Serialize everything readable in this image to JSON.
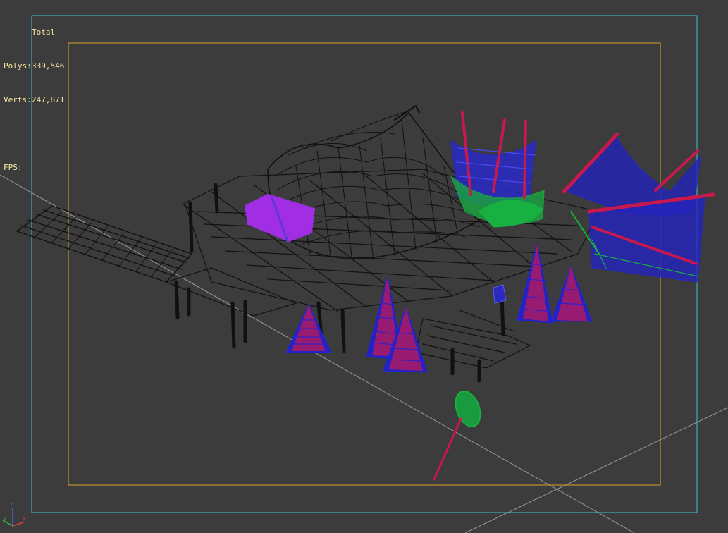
{
  "stats": {
    "header": "Total",
    "polys_label": "Polys:",
    "polys_value": "339,546",
    "verts_label": "Verts:",
    "verts_value": "247,871",
    "fps_label": "FPS:"
  },
  "colors": {
    "background": "#3c3c3c",
    "viewport_border": "#3fc0d0",
    "safe_frame": "#d8a030",
    "wire_black": "#111111",
    "wire_blue": "#2222d8",
    "wire_red": "#c8184c",
    "wire_green": "#18b040",
    "wire_purple": "#9c2ee0",
    "grid_line": "#b8b8b8"
  },
  "icons": {
    "axis_gizmo": "xyz-axis-icon"
  }
}
